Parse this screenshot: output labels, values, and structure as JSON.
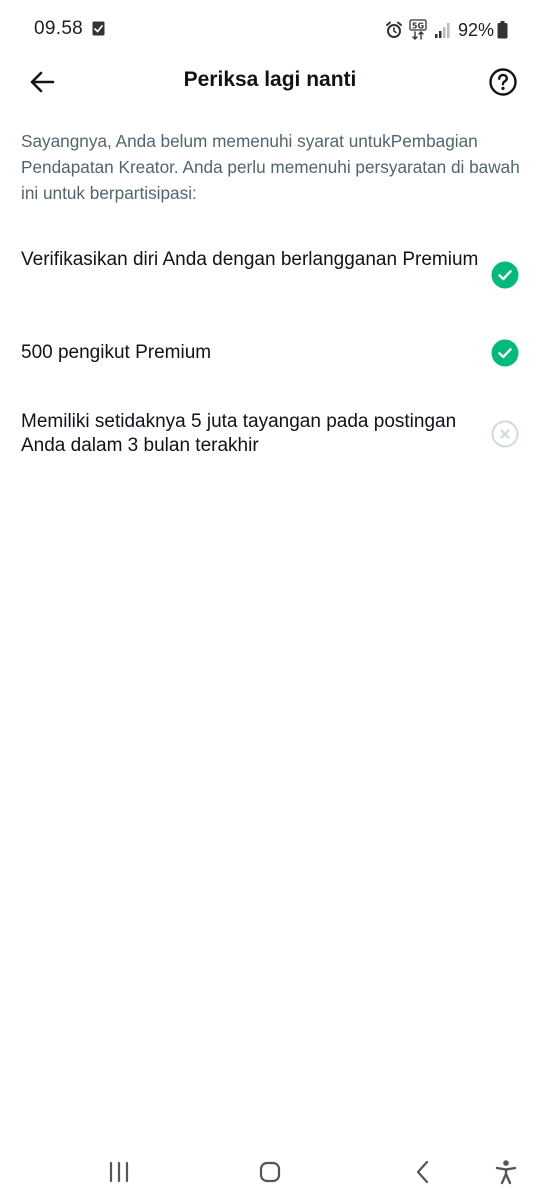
{
  "status_bar": {
    "time": "09.58",
    "battery_percent": "92%",
    "icons": [
      "task-check-icon",
      "alarm-icon",
      "5g-icon",
      "signal-icon",
      "battery-icon"
    ]
  },
  "header": {
    "title": "Periksa lagi nanti",
    "back_icon": "arrow-left-icon",
    "help_icon": "question-circle-icon"
  },
  "description": "Sayangnya, Anda belum memenuhi syarat untukPembagian Pendapatan Kreator. Anda perlu memenuhi persyaratan di bawah ini untuk berpartisipasi:",
  "requirements": [
    {
      "text": "Verifikasikan diri Anda dengan berlangganan Premium",
      "met": true,
      "icon": "check-circle-icon"
    },
    {
      "text": "500 pengikut Premium",
      "met": true,
      "icon": "check-circle-icon"
    },
    {
      "text": "Memiliki setidaknya 5 juta tayangan pada postingan Anda dalam 3 bulan terakhir",
      "met": false,
      "icon": "x-circle-icon"
    }
  ],
  "colors": {
    "met": "#00ba7c",
    "unmet": "#cfd9de",
    "description_text": "#536471",
    "primary_text": "#0f1419"
  },
  "nav_bar": {
    "icons": [
      "recent-apps-icon",
      "home-icon",
      "back-icon",
      "accessibility-icon"
    ]
  }
}
